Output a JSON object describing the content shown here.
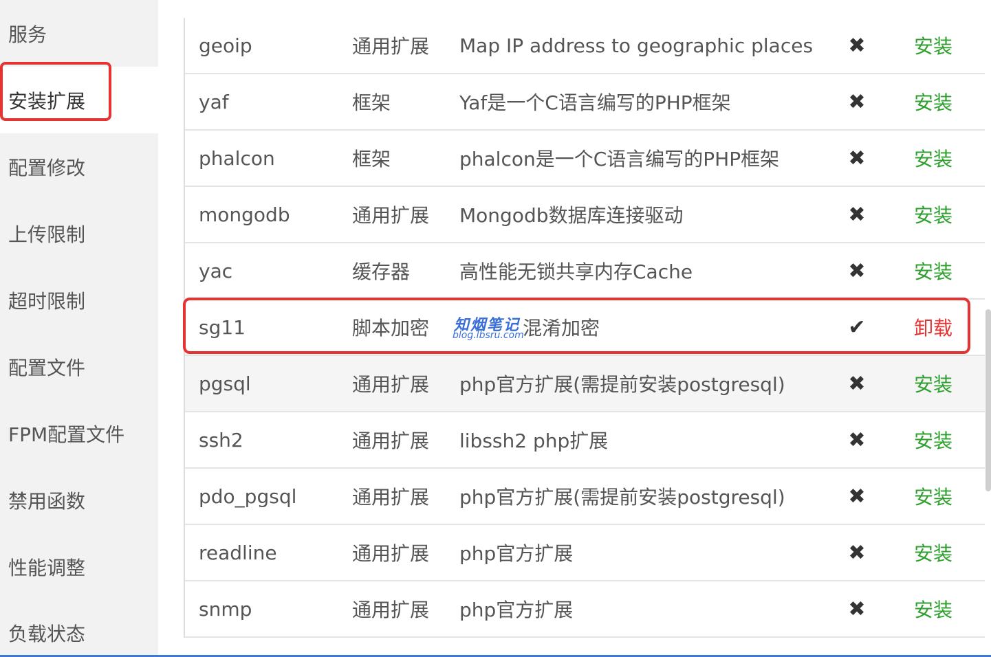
{
  "sidebar": {
    "items": [
      {
        "label": "服务"
      },
      {
        "label": "安装扩展"
      },
      {
        "label": "配置修改"
      },
      {
        "label": "上传限制"
      },
      {
        "label": "超时限制"
      },
      {
        "label": "配置文件"
      },
      {
        "label": "FPM配置文件"
      },
      {
        "label": "禁用函数"
      },
      {
        "label": "性能调整"
      },
      {
        "label": "负载状态"
      }
    ],
    "active_index": 1
  },
  "extensions": [
    {
      "name": "geoip",
      "type": "通用扩展",
      "desc": "Map IP address to geographic places",
      "status": "✖",
      "action": "安装"
    },
    {
      "name": "yaf",
      "type": "框架",
      "desc": "Yaf是一个C语言编写的PHP框架",
      "status": "✖",
      "action": "安装"
    },
    {
      "name": "phalcon",
      "type": "框架",
      "desc": "phalcon是一个C语言编写的PHP框架",
      "status": "✖",
      "action": "安装"
    },
    {
      "name": "mongodb",
      "type": "通用扩展",
      "desc": "Mongodb数据库连接驱动",
      "status": "✖",
      "action": "安装"
    },
    {
      "name": "yac",
      "type": "缓存器",
      "desc": "高性能无锁共享内存Cache",
      "status": "✖",
      "action": "安装"
    },
    {
      "name": "sg11",
      "type": "脚本加密",
      "desc": "混淆加密",
      "status": "✔",
      "action": "卸载"
    },
    {
      "name": "pgsql",
      "type": "通用扩展",
      "desc": "php官方扩展(需提前安装postgresql)",
      "status": "✖",
      "action": "安装"
    },
    {
      "name": "ssh2",
      "type": "通用扩展",
      "desc": "libssh2 php扩展",
      "status": "✖",
      "action": "安装"
    },
    {
      "name": "pdo_pgsql",
      "type": "通用扩展",
      "desc": "php官方扩展(需提前安装postgresql)",
      "status": "✖",
      "action": "安装"
    },
    {
      "name": "readline",
      "type": "通用扩展",
      "desc": "php官方扩展",
      "status": "✖",
      "action": "安装"
    },
    {
      "name": "snmp",
      "type": "通用扩展",
      "desc": "php官方扩展",
      "status": "✖",
      "action": "安装"
    }
  ],
  "watermark": {
    "title": "知烟笔记",
    "subtitle": "blog.lbsru.com"
  },
  "colors": {
    "install": "#2ea02e",
    "uninstall": "#e53333",
    "highlight": "#e53333"
  }
}
